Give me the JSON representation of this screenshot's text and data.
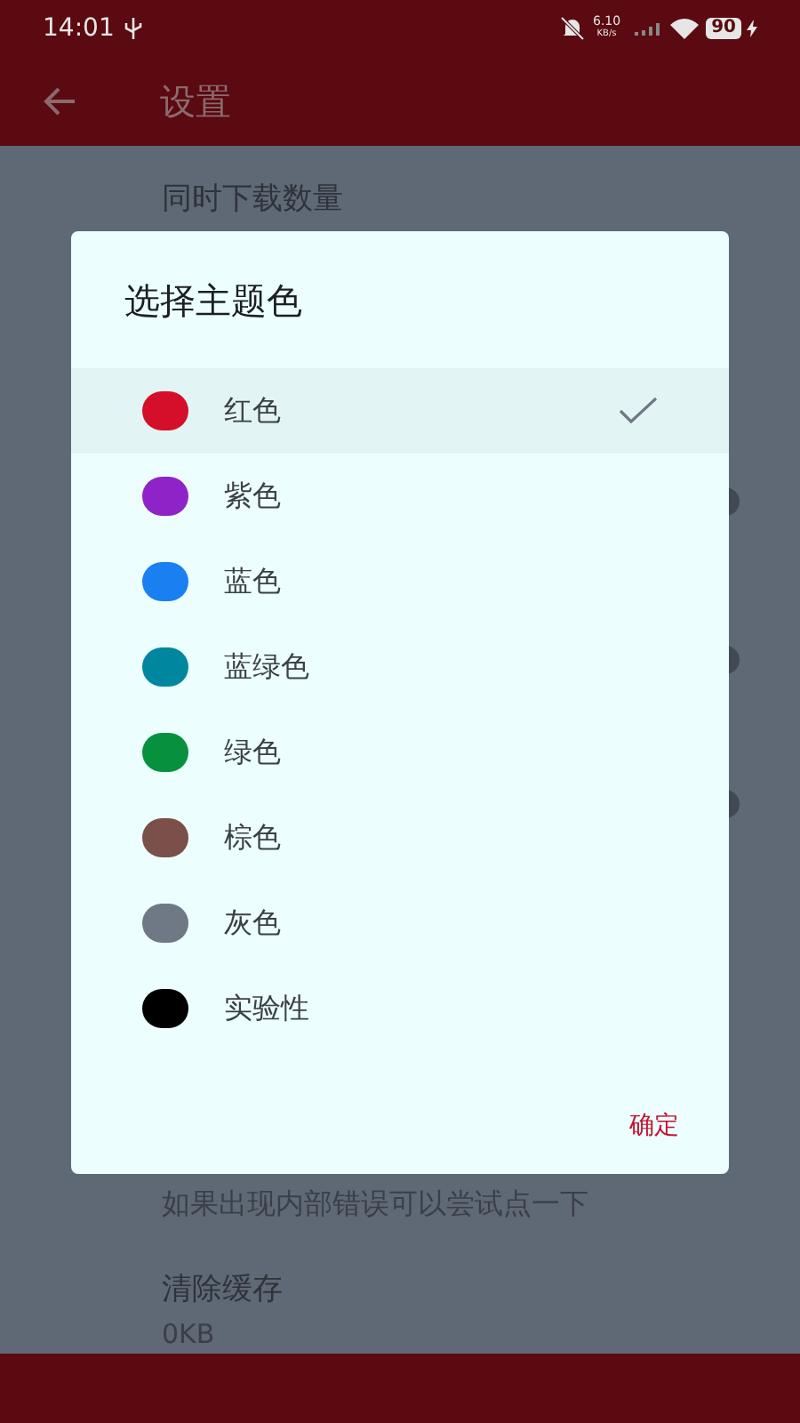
{
  "status_bar": {
    "time": "14:01",
    "speed": "6.10",
    "speed_unit": "KB/s",
    "battery": "90"
  },
  "app_bar": {
    "title": "设置"
  },
  "settings": [
    {
      "title": "同时下载数量"
    },
    {
      "title": "如果出现内部错误可以尝试点一下"
    },
    {
      "title": "清除缓存",
      "subtitle": "0KB"
    }
  ],
  "dialog": {
    "title": "选择主题色",
    "options": [
      {
        "label": "红色",
        "color": "#d50f2a",
        "selected": true
      },
      {
        "label": "紫色",
        "color": "#8e24c8",
        "selected": false
      },
      {
        "label": "蓝色",
        "color": "#1a7ff0",
        "selected": false
      },
      {
        "label": "蓝绿色",
        "color": "#00879f",
        "selected": false
      },
      {
        "label": "绿色",
        "color": "#07913f",
        "selected": false
      },
      {
        "label": "棕色",
        "color": "#7a5049",
        "selected": false
      },
      {
        "label": "灰色",
        "color": "#6f7885",
        "selected": false
      },
      {
        "label": "实验性",
        "color": "#000000",
        "selected": false
      }
    ],
    "confirm": "确定"
  }
}
